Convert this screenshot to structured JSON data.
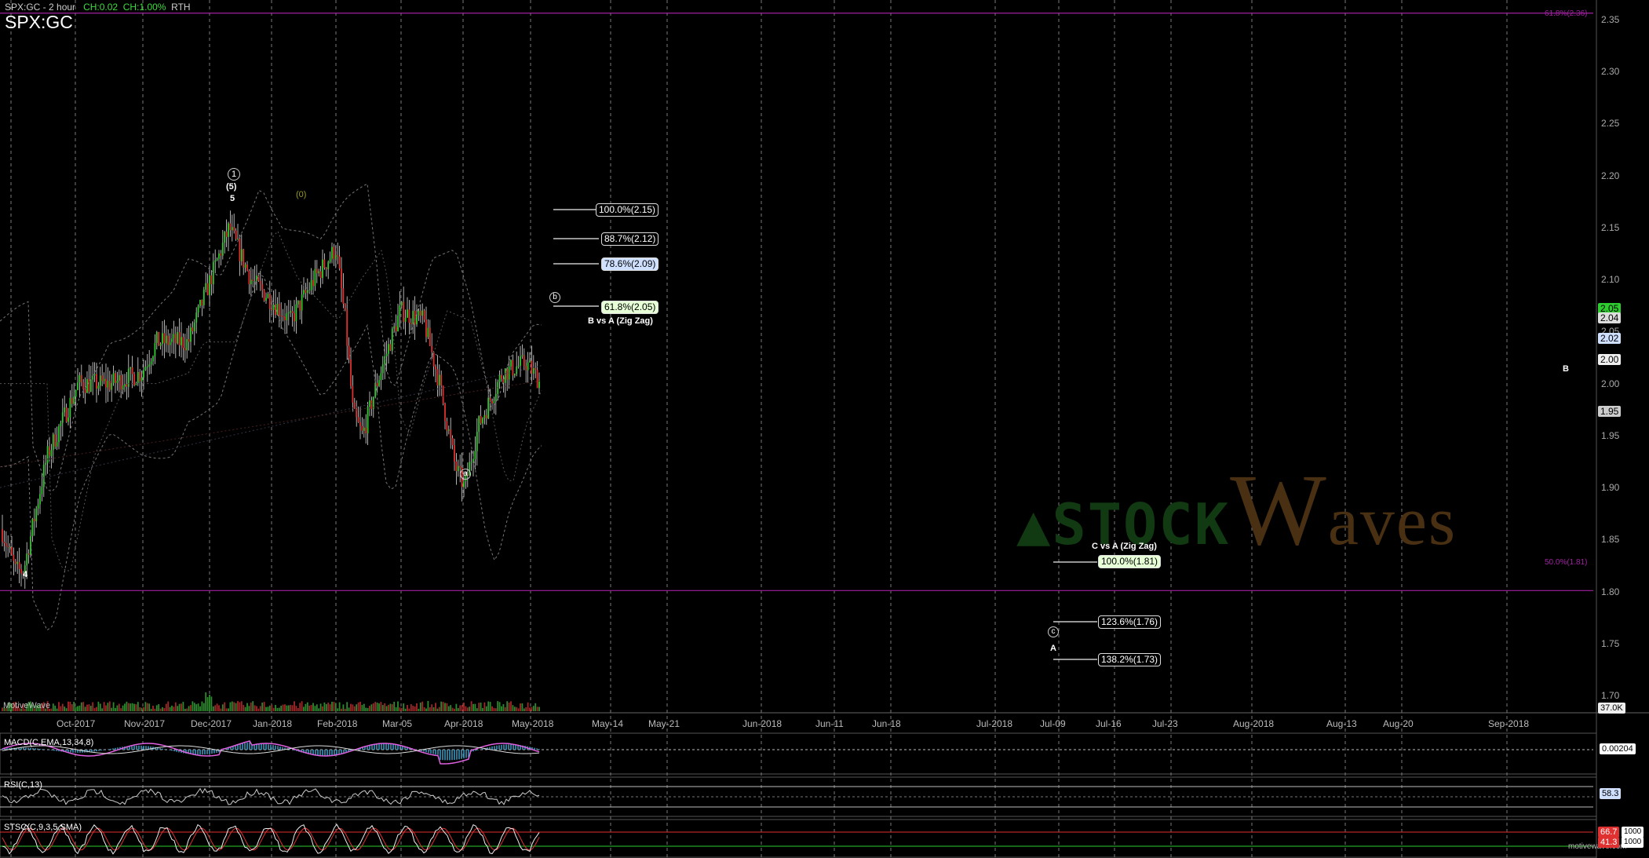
{
  "header": {
    "title": "SPX:GC - 2 hour",
    "change_abs": "CH:0.02",
    "change_pct": "CH:1.00%",
    "session": "RTH",
    "symbol": "SPX:GC"
  },
  "credit": "MotiveWave",
  "credit_bottom": "motivewave.com",
  "y_axis": {
    "labels": [
      "2.35",
      "2.30",
      "2.25",
      "2.20",
      "2.15",
      "2.10",
      "2.05",
      "2.00",
      "1.95",
      "1.90",
      "1.85",
      "1.80",
      "1.75",
      "1.70"
    ],
    "range": [
      1.69,
      2.365
    ]
  },
  "x_axis": {
    "labels": [
      "Oct-2017",
      "Nov-2017",
      "Dec-2017",
      "Jan-2018",
      "Feb-2018",
      "Mar-05",
      "Apr-2018",
      "May-2018",
      "May-14",
      "May-21",
      "Jun-2018",
      "Jun-11",
      "Jun-18",
      "Jul-2018",
      "Jul-09",
      "Jul-16",
      "Jul-23",
      "Aug-2018",
      "Aug-13",
      "Aug-20",
      "Sep-2018"
    ]
  },
  "price_tags": {
    "green": "2.05",
    "white1": "2.04",
    "blue": "2.02",
    "white2": "2.00",
    "grey": "1.95",
    "volume": "37.0K"
  },
  "fib_levels": {
    "top_line_label": "61.8%(2.36)",
    "mid_line_label": "50.0%(1.81)",
    "b_levels": [
      {
        "label": "100.0%(2.15)",
        "style": "plain"
      },
      {
        "label": "88.7%(2.12)",
        "style": "plain"
      },
      {
        "label": "78.6%(2.09)",
        "style": "blue"
      },
      {
        "label": "61.8%(2.05)",
        "style": "green"
      }
    ],
    "b_caption": "B vs A (Zig Zag)",
    "c_caption": "C vs A (Zig Zag)",
    "c_levels": [
      {
        "label": "100.0%(1.81)",
        "style": "green"
      },
      {
        "label": "123.6%(1.76)",
        "style": "plain"
      },
      {
        "label": "138.2%(1.73)",
        "style": "plain"
      }
    ]
  },
  "wave_labels": {
    "circle1": "1",
    "paren5": "(5)",
    "five": "5",
    "paren0": "(0)",
    "four": "4",
    "circle_a": "a",
    "circle_b": "b",
    "circle_c": "c",
    "big_a": "A",
    "big_b": "B"
  },
  "watermark": {
    "part1": "STOCK",
    "part2": "Waves",
    "part2_tail": "aves"
  },
  "panels": {
    "macd": {
      "label": "MACD(C,EMA,13,34,8)",
      "value": "0.00204"
    },
    "rsi": {
      "label": "RSI(C,13)",
      "value": "58.3"
    },
    "stoch": {
      "label": "STSC(C,9,3,5,SMA)",
      "value_top": "66.7",
      "value_bottom": "41.3",
      "tick_top": "1000",
      "tick_bottom": "1000"
    }
  },
  "colors": {
    "magenta": "#a020a0",
    "up": "#2ecc2e",
    "down": "#e03030"
  }
}
